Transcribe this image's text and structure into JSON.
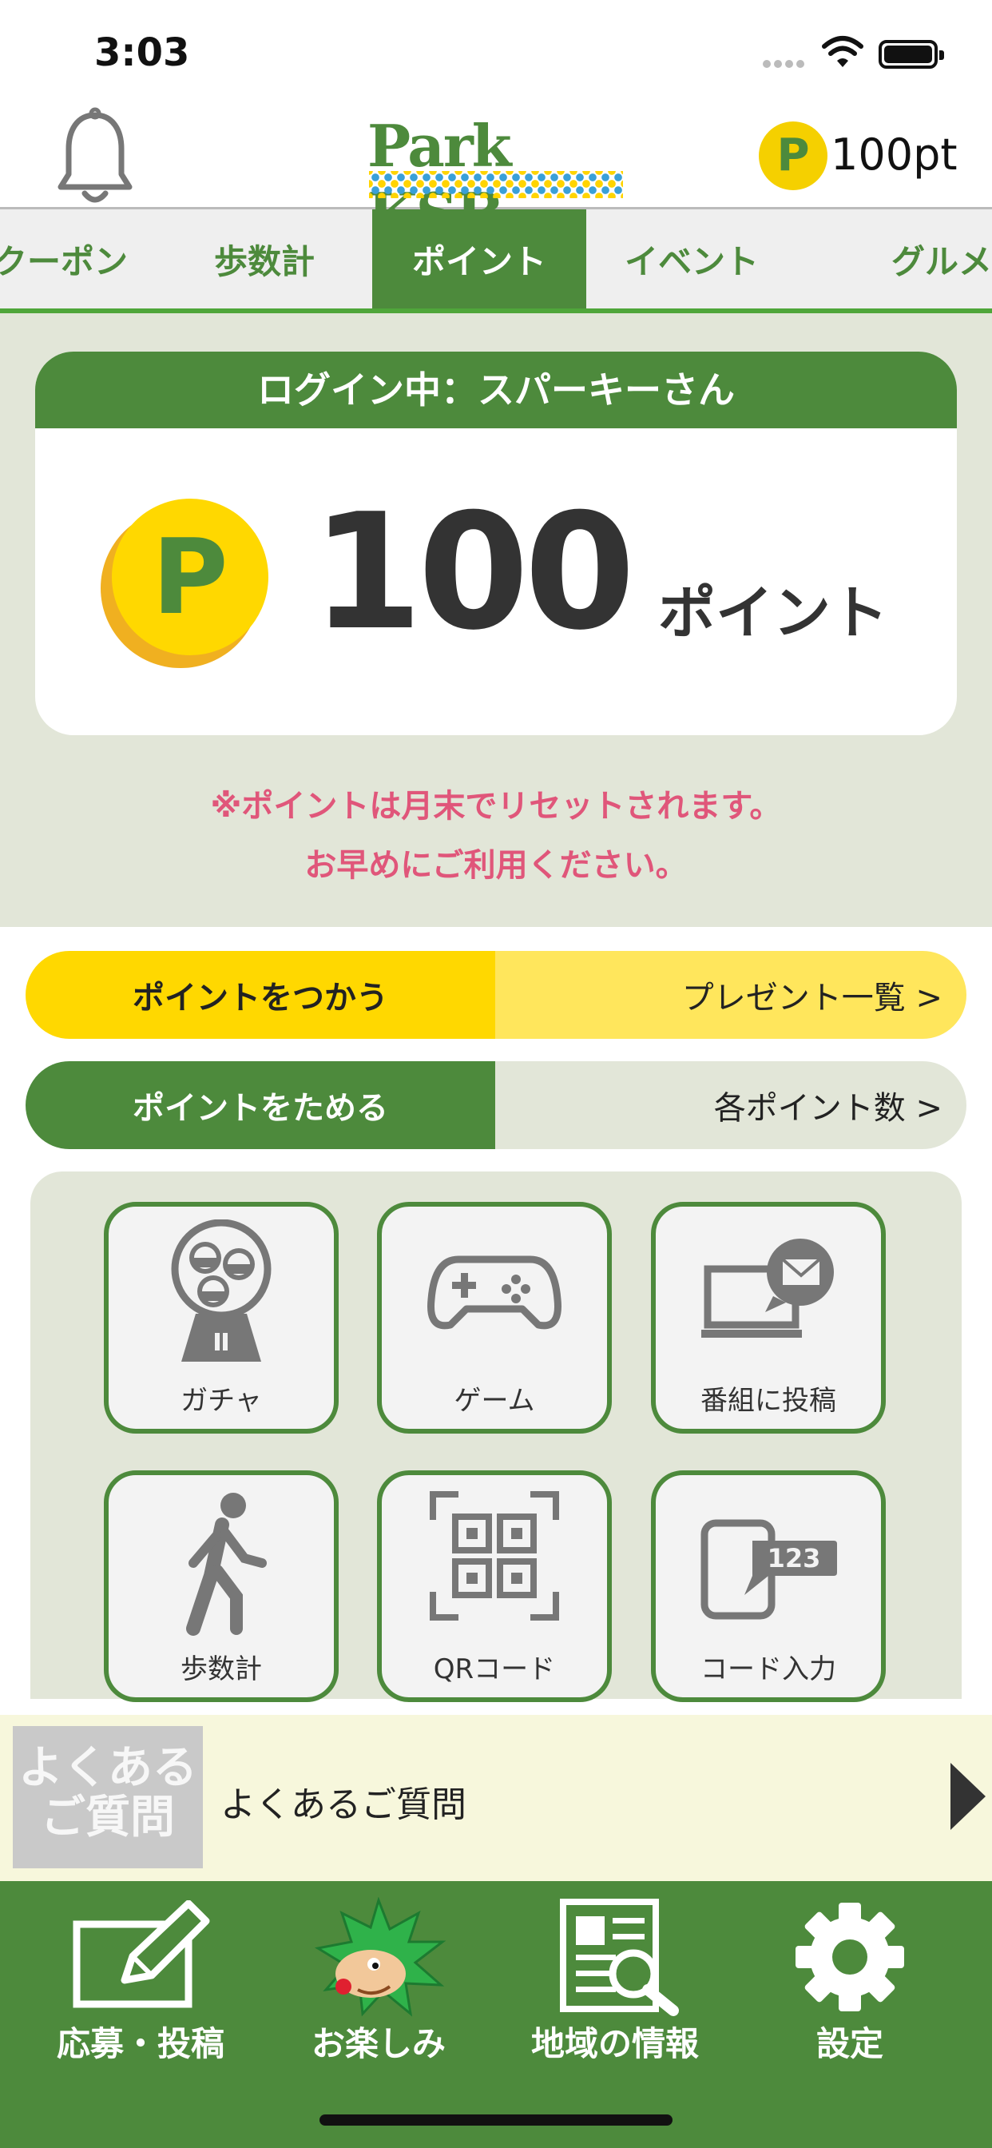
{
  "status_bar": {
    "time": "3:03"
  },
  "header": {
    "logo_text": "Park KSB",
    "points_badge_icon": "P",
    "points_label": "100pt"
  },
  "tabs": [
    {
      "label": "クーポン",
      "active": false
    },
    {
      "label": "歩数計",
      "active": false
    },
    {
      "label": "ポイント",
      "active": true
    },
    {
      "label": "イベント",
      "active": false
    },
    {
      "label": "グルメ",
      "active": false
    }
  ],
  "points_card": {
    "login_label": "ログイン中：スパーキーさん",
    "coin_icon": "P",
    "value": "100",
    "unit": "ポイント"
  },
  "notice": {
    "line1": "※ポイントは月末でリセットされます。",
    "line2": "お早めにご利用ください。"
  },
  "use_bar": {
    "left": "ポイントをつかう",
    "right": "プレゼント一覧 >"
  },
  "save_bar": {
    "left": "ポイントをためる",
    "right": "各ポイント数 >"
  },
  "tiles": [
    {
      "label": "ガチャ",
      "icon": "gacha-icon"
    },
    {
      "label": "ゲーム",
      "icon": "gamepad-icon"
    },
    {
      "label": "番組に投稿",
      "icon": "tv-mail-icon"
    },
    {
      "label": "歩数計",
      "icon": "walker-icon"
    },
    {
      "label": "QRコード",
      "icon": "qr-code-icon"
    },
    {
      "label": "コード入力",
      "icon": "code-input-icon"
    }
  ],
  "tile_code_text": "123",
  "faq": {
    "badge": "よくある\nご質問",
    "badge_line1": "よくある",
    "badge_line2": "ご質問",
    "label": "よくあるご質問"
  },
  "bottom_nav": [
    {
      "label": "応募・投稿",
      "icon": "edit-icon"
    },
    {
      "label": "お楽しみ",
      "icon": "mascot-icon"
    },
    {
      "label": "地域の情報",
      "icon": "newspaper-search-icon"
    },
    {
      "label": "設定",
      "icon": "gear-icon"
    }
  ],
  "colors": {
    "brand_green": "#4d8a3c",
    "accent_yellow": "#ffd800",
    "notice_pink": "#e0567a"
  }
}
